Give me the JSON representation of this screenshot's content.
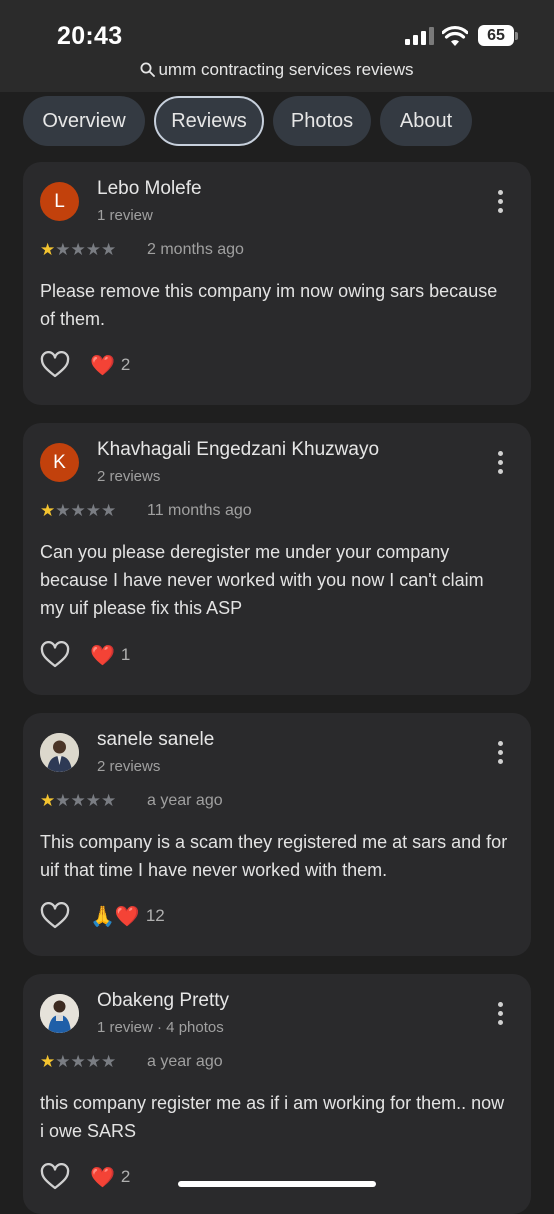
{
  "status_bar": {
    "time": "20:43",
    "battery": "65"
  },
  "search": {
    "query": "umm contracting services reviews"
  },
  "tabs": [
    {
      "label": "Overview",
      "active": false
    },
    {
      "label": "Reviews",
      "active": true
    },
    {
      "label": "Photos",
      "active": false
    },
    {
      "label": "About",
      "active": false
    }
  ],
  "reviews": [
    {
      "initial": "L",
      "name": "Lebo Molefe",
      "meta": "1 review",
      "rating": 1,
      "date": "2 months ago",
      "text": "Please remove this company im now owing sars because of them.",
      "reactions": "❤️",
      "count": "2"
    },
    {
      "initial": "K",
      "name": "Khavhagali Engedzani Khuzwayo",
      "meta": "2 reviews",
      "rating": 1,
      "date": "11 months ago",
      "text": "Can you please deregister me under your company because I have never worked with you now I can't claim my uif please fix this ASP",
      "reactions": "❤️",
      "count": "1"
    },
    {
      "initial": "",
      "name": "sanele sanele",
      "meta": "2 reviews",
      "rating": 1,
      "date": "a year ago",
      "text": "This company is a scam they registered me at sars and for uif that time I have never worked with them.",
      "reactions": "🙏❤️",
      "count": "12"
    },
    {
      "initial": "",
      "name": "Obakeng Pretty",
      "meta": "1 review · 4 photos",
      "rating": 1,
      "date": "a year ago",
      "text": "this company register me as if i am working for them.. now i owe SARS",
      "reactions": "❤️",
      "count": "2"
    }
  ],
  "colors": {
    "avatar_orange": "#c2410c",
    "star": "#f4c430",
    "card": "#2a2a2c",
    "background": "#1f1f1f"
  }
}
